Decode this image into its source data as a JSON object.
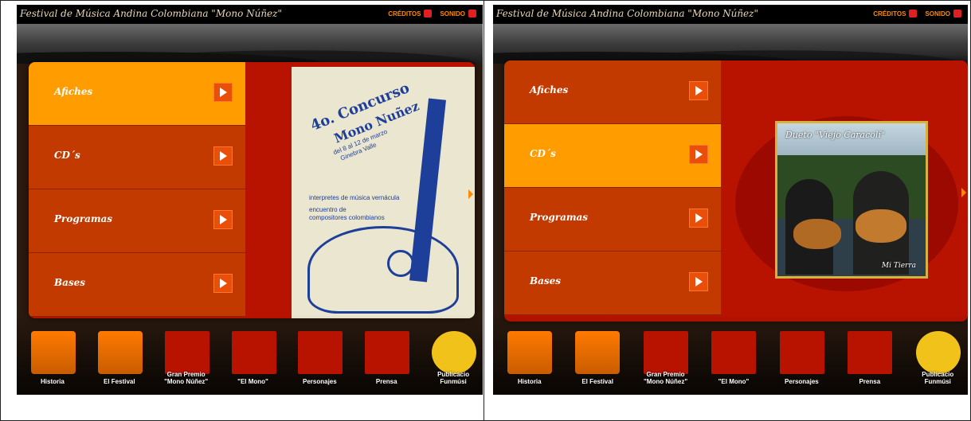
{
  "header": {
    "site_title": "Festival de Música Andina Colombiana \"Mono Núñez\"",
    "credits_label": "CRÉDITOS",
    "sound_label": "SONIDO"
  },
  "menu": {
    "items": [
      {
        "label": "Afiches"
      },
      {
        "label": "CD´s"
      },
      {
        "label": "Programas"
      },
      {
        "label": "Bases"
      }
    ]
  },
  "left_view": {
    "poster": {
      "line1": "4o. Concurso",
      "line2": "Mono Nuñez",
      "line3": "del 8 al 12 de marzo",
      "line4": "Ginebra Valle",
      "line5": "interpretes de música vernácula",
      "line6": "encuentro de",
      "line7": "compositores colombianos"
    }
  },
  "right_view": {
    "cd": {
      "title": "Dueto \"Viejo Caracolí\"",
      "subtitle": "Mi Tierra"
    }
  },
  "dock": {
    "items": [
      {
        "label": "Historia",
        "label2": ""
      },
      {
        "label": "El Festival",
        "label2": ""
      },
      {
        "label": "Gran Premio",
        "label2": "\"Mono Núñez\""
      },
      {
        "label": "\"El Mono\"",
        "label2": ""
      },
      {
        "label": "Personajes",
        "label2": ""
      },
      {
        "label": "Prensa",
        "label2": ""
      },
      {
        "label": "Publicacio",
        "label2": "Funmúsi"
      }
    ]
  },
  "colors": {
    "active": "#ff9d00",
    "menu": "#c23a00",
    "card": "#b81200",
    "accent": "#ff8a00"
  }
}
